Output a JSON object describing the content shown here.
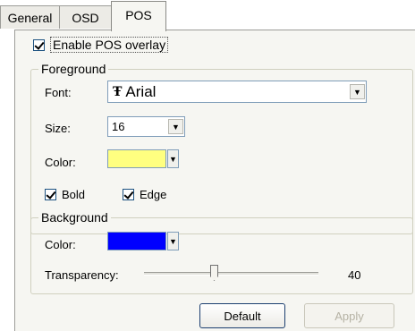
{
  "tabs": {
    "general": "General",
    "osd": "OSD",
    "pos": "POS"
  },
  "enable_overlay": {
    "label": "Enable POS overlay",
    "checked": true
  },
  "foreground": {
    "legend": "Foreground",
    "font_label": "Font:",
    "font_icon_glyph": "Ŧ",
    "font_value": "Arial",
    "size_label": "Size:",
    "size_value": "16",
    "color_label": "Color:",
    "color_value": "#ffff80",
    "bold_label": "Bold",
    "bold_checked": true,
    "edge_label": "Edge",
    "edge_checked": true
  },
  "background": {
    "legend": "Background",
    "color_label": "Color:",
    "color_value": "#0000ff",
    "transparency_label": "Transparency:",
    "transparency_value": "40",
    "transparency_max": 100
  },
  "buttons": {
    "default": "Default",
    "apply": "Apply",
    "apply_enabled": false
  },
  "icons": {
    "dropdown_arrow": "▼"
  }
}
